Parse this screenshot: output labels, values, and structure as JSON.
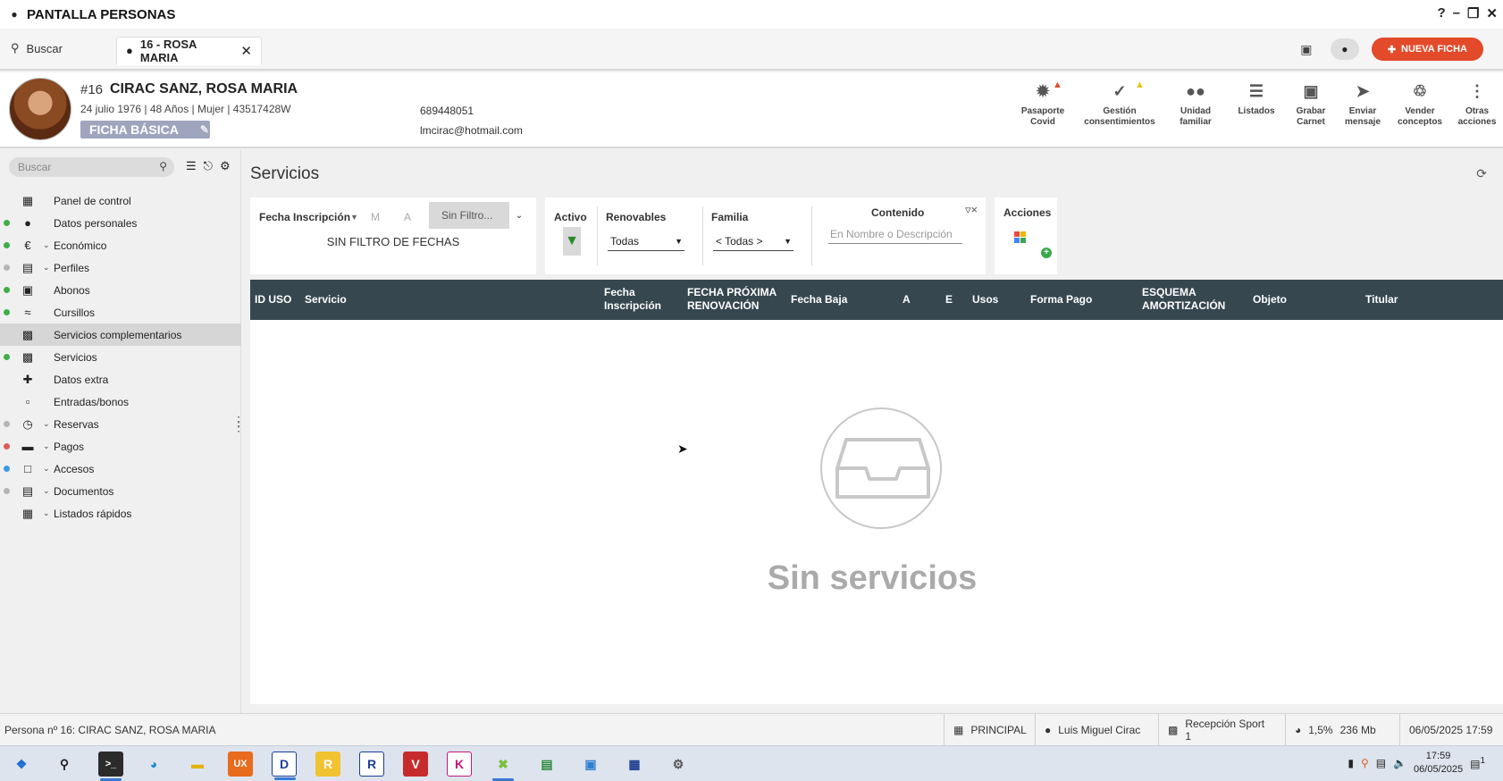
{
  "window": {
    "title": "PANTALLA PERSONAS",
    "controls": [
      "?",
      "–",
      "❐",
      "✕"
    ]
  },
  "tabs": {
    "search_label": "Buscar",
    "record_tab": "16 - ROSA MARIA",
    "new_button": "NUEVA FICHA"
  },
  "person": {
    "number": "#16",
    "name": "CIRAC SANZ, ROSA MARIA",
    "info": "24 julio 1976 | 48 Años | Mujer | 43517428W",
    "badge": "FICHA BÁSICA",
    "phone": "689448051",
    "email": "lmcirac@hotmail.com"
  },
  "actions": [
    {
      "label1": "Pasaporte",
      "label2": "Covid",
      "icon": "virus-icon",
      "warn": "red"
    },
    {
      "label1": "Gestión",
      "label2": "consentimientos",
      "icon": "consent-icon",
      "warn": "yellow"
    },
    {
      "label1": "Unidad",
      "label2": "familiar",
      "icon": "family-icon"
    },
    {
      "label1": "Listados",
      "label2": "",
      "icon": "list-icon"
    },
    {
      "label1": "Grabar",
      "label2": "Carnet",
      "icon": "card-icon"
    },
    {
      "label1": "Enviar",
      "label2": "mensaje",
      "icon": "send-icon"
    },
    {
      "label1": "Vender",
      "label2": "conceptos",
      "icon": "sell-icon"
    },
    {
      "label1": "Otras",
      "label2": "acciones",
      "icon": "more-icon"
    }
  ],
  "sidebar": {
    "search_placeholder": "Buscar",
    "items": [
      {
        "label": "Panel de control",
        "icon": "dashboard-icon",
        "dot": "",
        "chevron": false
      },
      {
        "label": "Datos personales",
        "icon": "person-icon",
        "dot": "#3fae49",
        "chevron": false
      },
      {
        "label": "Económico",
        "icon": "euro-icon",
        "dot": "#3fae49",
        "chevron": true
      },
      {
        "label": "Perfiles",
        "icon": "clipboard-icon",
        "dot": "#b5b5b5",
        "chevron": true
      },
      {
        "label": "Abonos",
        "icon": "calendar-icon",
        "dot": "#3fae49",
        "chevron": false
      },
      {
        "label": "Cursillos",
        "icon": "swim-icon",
        "dot": "#3fae49",
        "chevron": false
      },
      {
        "label": "Servicios complementarios",
        "icon": "monitor-icon",
        "dot": "",
        "chevron": false,
        "selected": true
      },
      {
        "label": "Servicios",
        "icon": "monitor-icon",
        "dot": "#3fae49",
        "chevron": false
      },
      {
        "label": "Datos extra",
        "icon": "person-add-icon",
        "dot": "",
        "chevron": false
      },
      {
        "label": "Entradas/bonos",
        "icon": "ticket-icon",
        "dot": "",
        "chevron": false
      },
      {
        "label": "Reservas",
        "icon": "calendar-clock-icon",
        "dot": "#b5b5b5",
        "chevron": true
      },
      {
        "label": "Pagos",
        "icon": "credit-card-icon",
        "dot": "#e05a5a",
        "chevron": true
      },
      {
        "label": "Accesos",
        "icon": "lock-icon",
        "dot": "#3b9be0",
        "chevron": true
      },
      {
        "label": "Documentos",
        "icon": "document-icon",
        "dot": "#b5b5b5",
        "chevron": true
      },
      {
        "label": "Listados rápidos",
        "icon": "table-icon",
        "dot": "",
        "chevron": true
      }
    ]
  },
  "main": {
    "title": "Servicios",
    "filters": {
      "date_field": "Fecha Inscripción",
      "m": "M",
      "a": "A",
      "date_filter": "Sin Filtro...",
      "no_filter_text": "SIN FILTRO DE FECHAS",
      "activo_label": "Activo",
      "renovables_label": "Renovables",
      "renovables_value": "Todas",
      "familia_label": "Familia",
      "familia_value": "< Todas >",
      "contenido_label": "Contenido",
      "contenido_placeholder": "En Nombre o Descripción",
      "acciones_label": "Acciones"
    },
    "columns": [
      {
        "label": "ID USO"
      },
      {
        "label": "Servicio"
      },
      {
        "label": "Fecha\nInscripción"
      },
      {
        "label": "FECHA PRÓXIMA\nRENOVACIÓN"
      },
      {
        "label": "Fecha Baja"
      },
      {
        "label": "A"
      },
      {
        "label": "E"
      },
      {
        "label": "Usos"
      },
      {
        "label": "Forma Pago"
      },
      {
        "label": "ESQUEMA\nAMORTIZACIÓN"
      },
      {
        "label": "Objeto"
      },
      {
        "label": "Titular"
      }
    ],
    "empty_text": "Sin servicios"
  },
  "status": {
    "left": "Persona nº 16: CIRAC SANZ, ROSA MARIA",
    "station": "PRINCIPAL",
    "user": "Luis Miguel Cirac",
    "location": "Recepción Sport 1",
    "cpu": "1,5%",
    "mem": "236 Mb",
    "datetime": "06/05/2025 17:59"
  },
  "taskbar": {
    "time": "17:59",
    "date": "06/05/2025",
    "notifications": "1"
  },
  "colors": {
    "accent": "#e24a2a",
    "grid_header": "#36474f",
    "badge": "#9fa5bd"
  }
}
